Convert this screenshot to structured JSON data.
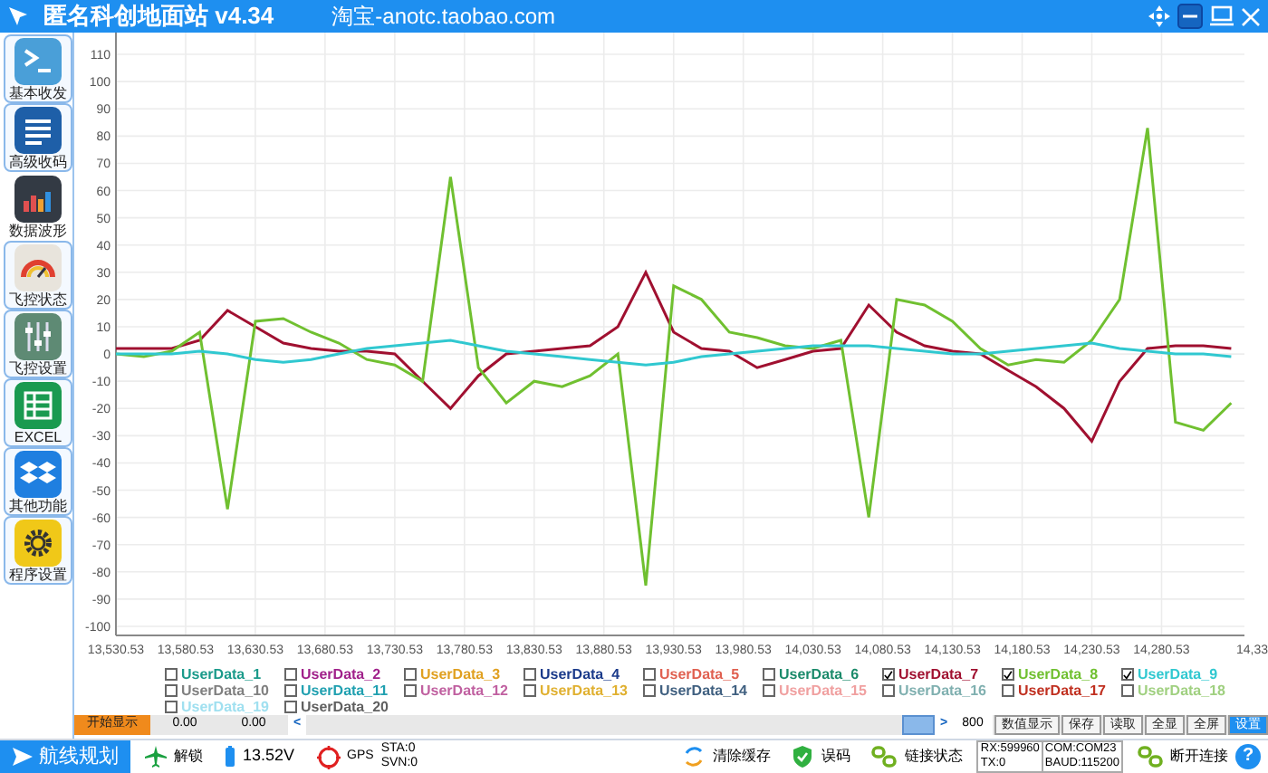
{
  "window": {
    "title": "匿名科创地面站 v4.34",
    "subtitle": "淘宝-anotc.taobao.com"
  },
  "sidebar": {
    "items": [
      {
        "label": "基本收发",
        "kind": "terminal",
        "selected": false
      },
      {
        "label": "高级收码",
        "kind": "list",
        "selected": false
      },
      {
        "label": "数据波形",
        "kind": "bars",
        "selected": true
      },
      {
        "label": "飞控状态",
        "kind": "gauge",
        "selected": false
      },
      {
        "label": "飞控设置",
        "kind": "sliders",
        "selected": false
      },
      {
        "label": "EXCEL",
        "kind": "sheet",
        "selected": false
      },
      {
        "label": "其他功能",
        "kind": "boxes",
        "selected": false
      },
      {
        "label": "程序设置",
        "kind": "gear",
        "selected": false
      }
    ]
  },
  "chart": {
    "chart_data": {
      "type": "line",
      "x": [
        13530.53,
        13550.53,
        13570.53,
        13590.53,
        13610.53,
        13630.53,
        13650.53,
        13670.53,
        13690.53,
        13710.53,
        13730.53,
        13750.53,
        13770.53,
        13790.53,
        13810.53,
        13830.53,
        13850.53,
        13870.53,
        13890.53,
        13910.53,
        13930.53,
        13950.53,
        13970.53,
        13990.53,
        14010.53,
        14030.53,
        14050.53,
        14070.53,
        14090.53,
        14110.53,
        14130.53,
        14150.53,
        14170.53,
        14190.53,
        14210.53,
        14230.53,
        14250.53,
        14270.53,
        14290.53,
        14310.53,
        14330.53
      ],
      "series": [
        {
          "color": "#a01030",
          "values": [
            2,
            2,
            2,
            5,
            16,
            10,
            4,
            2,
            1,
            1,
            0,
            -10,
            -20,
            -8,
            0,
            1,
            2,
            3,
            10,
            30,
            8,
            2,
            1,
            -5,
            -2,
            1,
            2,
            18,
            8,
            3,
            1,
            0,
            -6,
            -12,
            -20,
            -32,
            -10,
            2,
            3,
            3,
            2
          ]
        },
        {
          "color": "#70c030",
          "values": [
            0,
            -1,
            1,
            8,
            -57,
            12,
            13,
            8,
            4,
            -2,
            -4,
            -10,
            65,
            -5,
            -18,
            -10,
            -12,
            -8,
            0,
            -85,
            25,
            20,
            8,
            6,
            3,
            2,
            5,
            -60,
            20,
            18,
            12,
            2,
            -4,
            -2,
            -3,
            5,
            20,
            83,
            -25,
            -28,
            -18
          ]
        },
        {
          "color": "#30c8d0",
          "values": [
            0,
            0,
            0,
            1,
            0,
            -2,
            -3,
            -2,
            0,
            2,
            3,
            4,
            5,
            3,
            1,
            0,
            -1,
            -2,
            -3,
            -4,
            -3,
            -1,
            0,
            1,
            2,
            3,
            3,
            3,
            2,
            1,
            0,
            0,
            1,
            2,
            3,
            4,
            2,
            1,
            0,
            0,
            -1
          ]
        }
      ],
      "xlim": [
        13530.53,
        14340
      ],
      "ylim": [
        -100,
        118
      ],
      "grid": true,
      "xticks": [
        {
          "value": 13530.53,
          "label": "13,530.53"
        },
        {
          "value": 13580.53,
          "label": "13,580.53"
        },
        {
          "value": 13630.53,
          "label": "13,630.53"
        },
        {
          "value": 13680.53,
          "label": "13,680.53"
        },
        {
          "value": 13730.53,
          "label": "13,730.53"
        },
        {
          "value": 13780.53,
          "label": "13,780.53"
        },
        {
          "value": 13830.53,
          "label": "13,830.53"
        },
        {
          "value": 13880.53,
          "label": "13,880.53"
        },
        {
          "value": 13930.53,
          "label": "13,930.53"
        },
        {
          "value": 13980.53,
          "label": "13,980.53"
        },
        {
          "value": 14030.53,
          "label": "14,030.53"
        },
        {
          "value": 14080.53,
          "label": "14,080.53"
        },
        {
          "value": 14130.53,
          "label": "14,130.53"
        },
        {
          "value": 14180.53,
          "label": "14,180.53"
        },
        {
          "value": 14230.53,
          "label": "14,230.53"
        },
        {
          "value": 14280.53,
          "label": "14,280.53"
        }
      ],
      "yticks": [
        -100,
        -90,
        -80,
        -70,
        -60,
        -50,
        -40,
        -30,
        -20,
        -10,
        0,
        10,
        20,
        30,
        40,
        50,
        60,
        70,
        80,
        90,
        100,
        110
      ]
    },
    "edge_tick": "14,33"
  },
  "channels": [
    {
      "name": "UserData_1",
      "color": "#1a9a8a",
      "checked": false
    },
    {
      "name": "UserData_2",
      "color": "#a0208a",
      "checked": false
    },
    {
      "name": "UserData_3",
      "color": "#e0a020",
      "checked": false
    },
    {
      "name": "UserData_4",
      "color": "#1a3a8a",
      "checked": false
    },
    {
      "name": "UserData_5",
      "color": "#e06050",
      "checked": false
    },
    {
      "name": "UserData_6",
      "color": "#1a8a6a",
      "checked": false
    },
    {
      "name": "UserData_7",
      "color": "#a01030",
      "checked": true
    },
    {
      "name": "UserData_8",
      "color": "#70c030",
      "checked": true
    },
    {
      "name": "UserData_9",
      "color": "#30c8d0",
      "checked": true
    },
    {
      "name": "UserData_10",
      "color": "#808080",
      "checked": false
    },
    {
      "name": "UserData_11",
      "color": "#20a0b0",
      "checked": false
    },
    {
      "name": "UserData_12",
      "color": "#c060a0",
      "checked": false
    },
    {
      "name": "UserData_13",
      "color": "#e0b030",
      "checked": false
    },
    {
      "name": "UserData_14",
      "color": "#406080",
      "checked": false
    },
    {
      "name": "UserData_15",
      "color": "#f0a0a0",
      "checked": false
    },
    {
      "name": "UserData_16",
      "color": "#80b0b0",
      "checked": false
    },
    {
      "name": "UserData_17",
      "color": "#c03020",
      "checked": false
    },
    {
      "name": "UserData_18",
      "color": "#a0d080",
      "checked": false
    },
    {
      "name": "UserData_19",
      "color": "#a0e0f0",
      "checked": false
    },
    {
      "name": "UserData_20",
      "color": "#606060",
      "checked": false
    }
  ],
  "controls": {
    "start": "开始显示",
    "from": "0.00",
    "to": "0.00",
    "prev": "<",
    "next": ">",
    "span": "800",
    "buttons": [
      {
        "label": "数值显示",
        "selected": false
      },
      {
        "label": "保存",
        "selected": false
      },
      {
        "label": "读取",
        "selected": false
      },
      {
        "label": "全显",
        "selected": false
      },
      {
        "label": "全屏",
        "selected": false
      },
      {
        "label": "设置",
        "selected": true
      }
    ]
  },
  "status_bar": {
    "route": "航线规划",
    "lock": "解锁",
    "voltage": "13.52V",
    "gps": "GPS",
    "sta": "STA:0",
    "svn": "SVN:0",
    "clear": "清除缓存",
    "error": "误码",
    "link": "链接状态",
    "rx": "RX:599960",
    "tx": "TX:0",
    "com": "COM:COM23",
    "baud": "BAUD:115200",
    "disconnect": "断开连接",
    "help": "?"
  }
}
